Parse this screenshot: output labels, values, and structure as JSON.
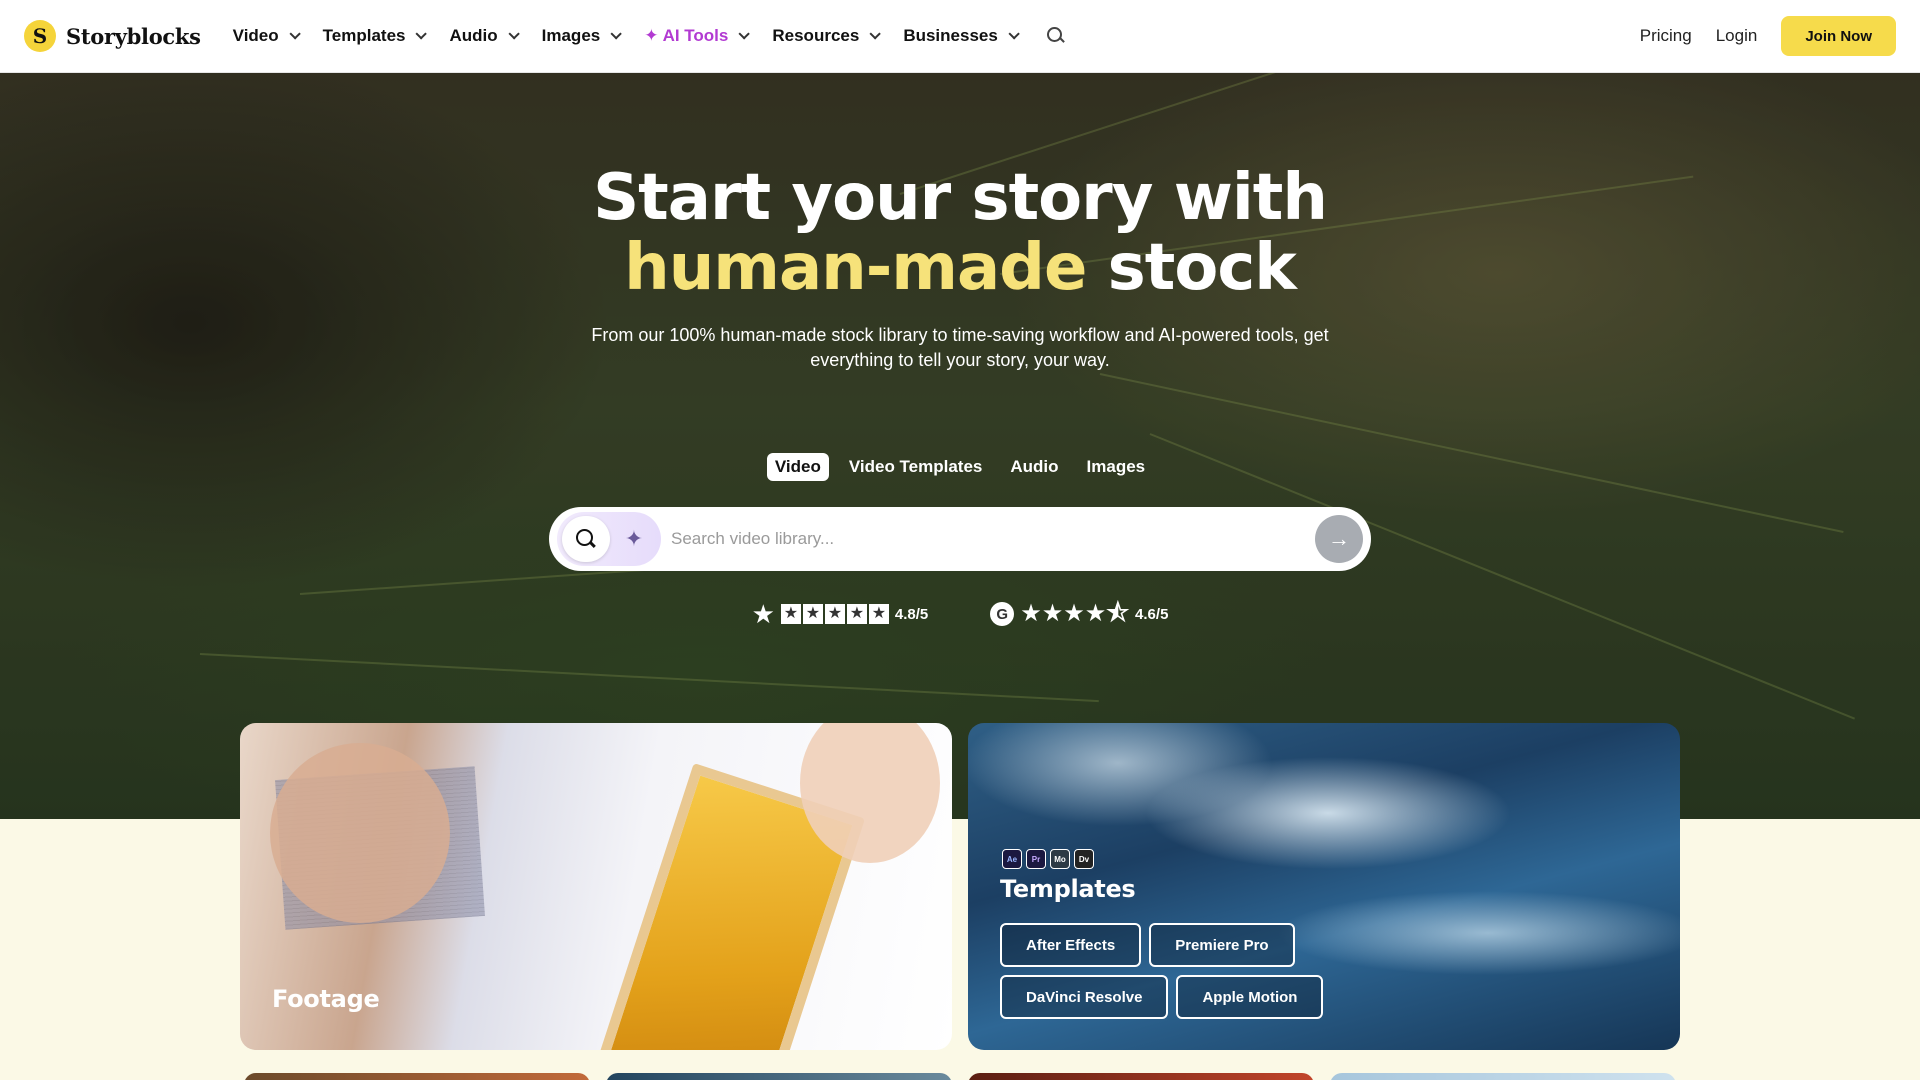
{
  "nav": {
    "logo_mark": "S",
    "logo_text": "Storyblocks",
    "menu": [
      {
        "label": "Video"
      },
      {
        "label": "Templates"
      },
      {
        "label": "Audio"
      },
      {
        "label": "Images"
      },
      {
        "label": "✦ AI Tools"
      },
      {
        "label": "Resources"
      },
      {
        "label": "Businesses"
      }
    ],
    "pricing": "Pricing",
    "login": "Login",
    "join": "Join Now"
  },
  "hero": {
    "headline_line1": "Start your story with",
    "headline_highlight": "human-made",
    "headline_tail": " stock",
    "subtitle": "From our 100% human-made stock library to time-saving workflow and AI-powered tools, get everything to tell your story, your way.",
    "tabs": [
      "Video",
      "Video Templates",
      "Audio",
      "Images"
    ],
    "active_tab": "Video",
    "search_placeholder": "Search video library...",
    "trustpilot_rating": "4.8/5",
    "g2_rating": "4.6/5"
  },
  "cards": {
    "footage": {
      "title": "Footage"
    },
    "templates": {
      "title": "Templates",
      "app_icons": [
        "Ae",
        "Pr",
        "Mo",
        "Dv"
      ],
      "buttons": [
        "After Effects",
        "Premiere Pro",
        "DaVinci Resolve",
        "Apple Motion"
      ]
    }
  },
  "colors": {
    "accent_yellow": "#f6db4b",
    "headline_highlight": "#f6e27a",
    "ai_tools": "#b23ad2",
    "page_background": "#fbf9e6"
  }
}
